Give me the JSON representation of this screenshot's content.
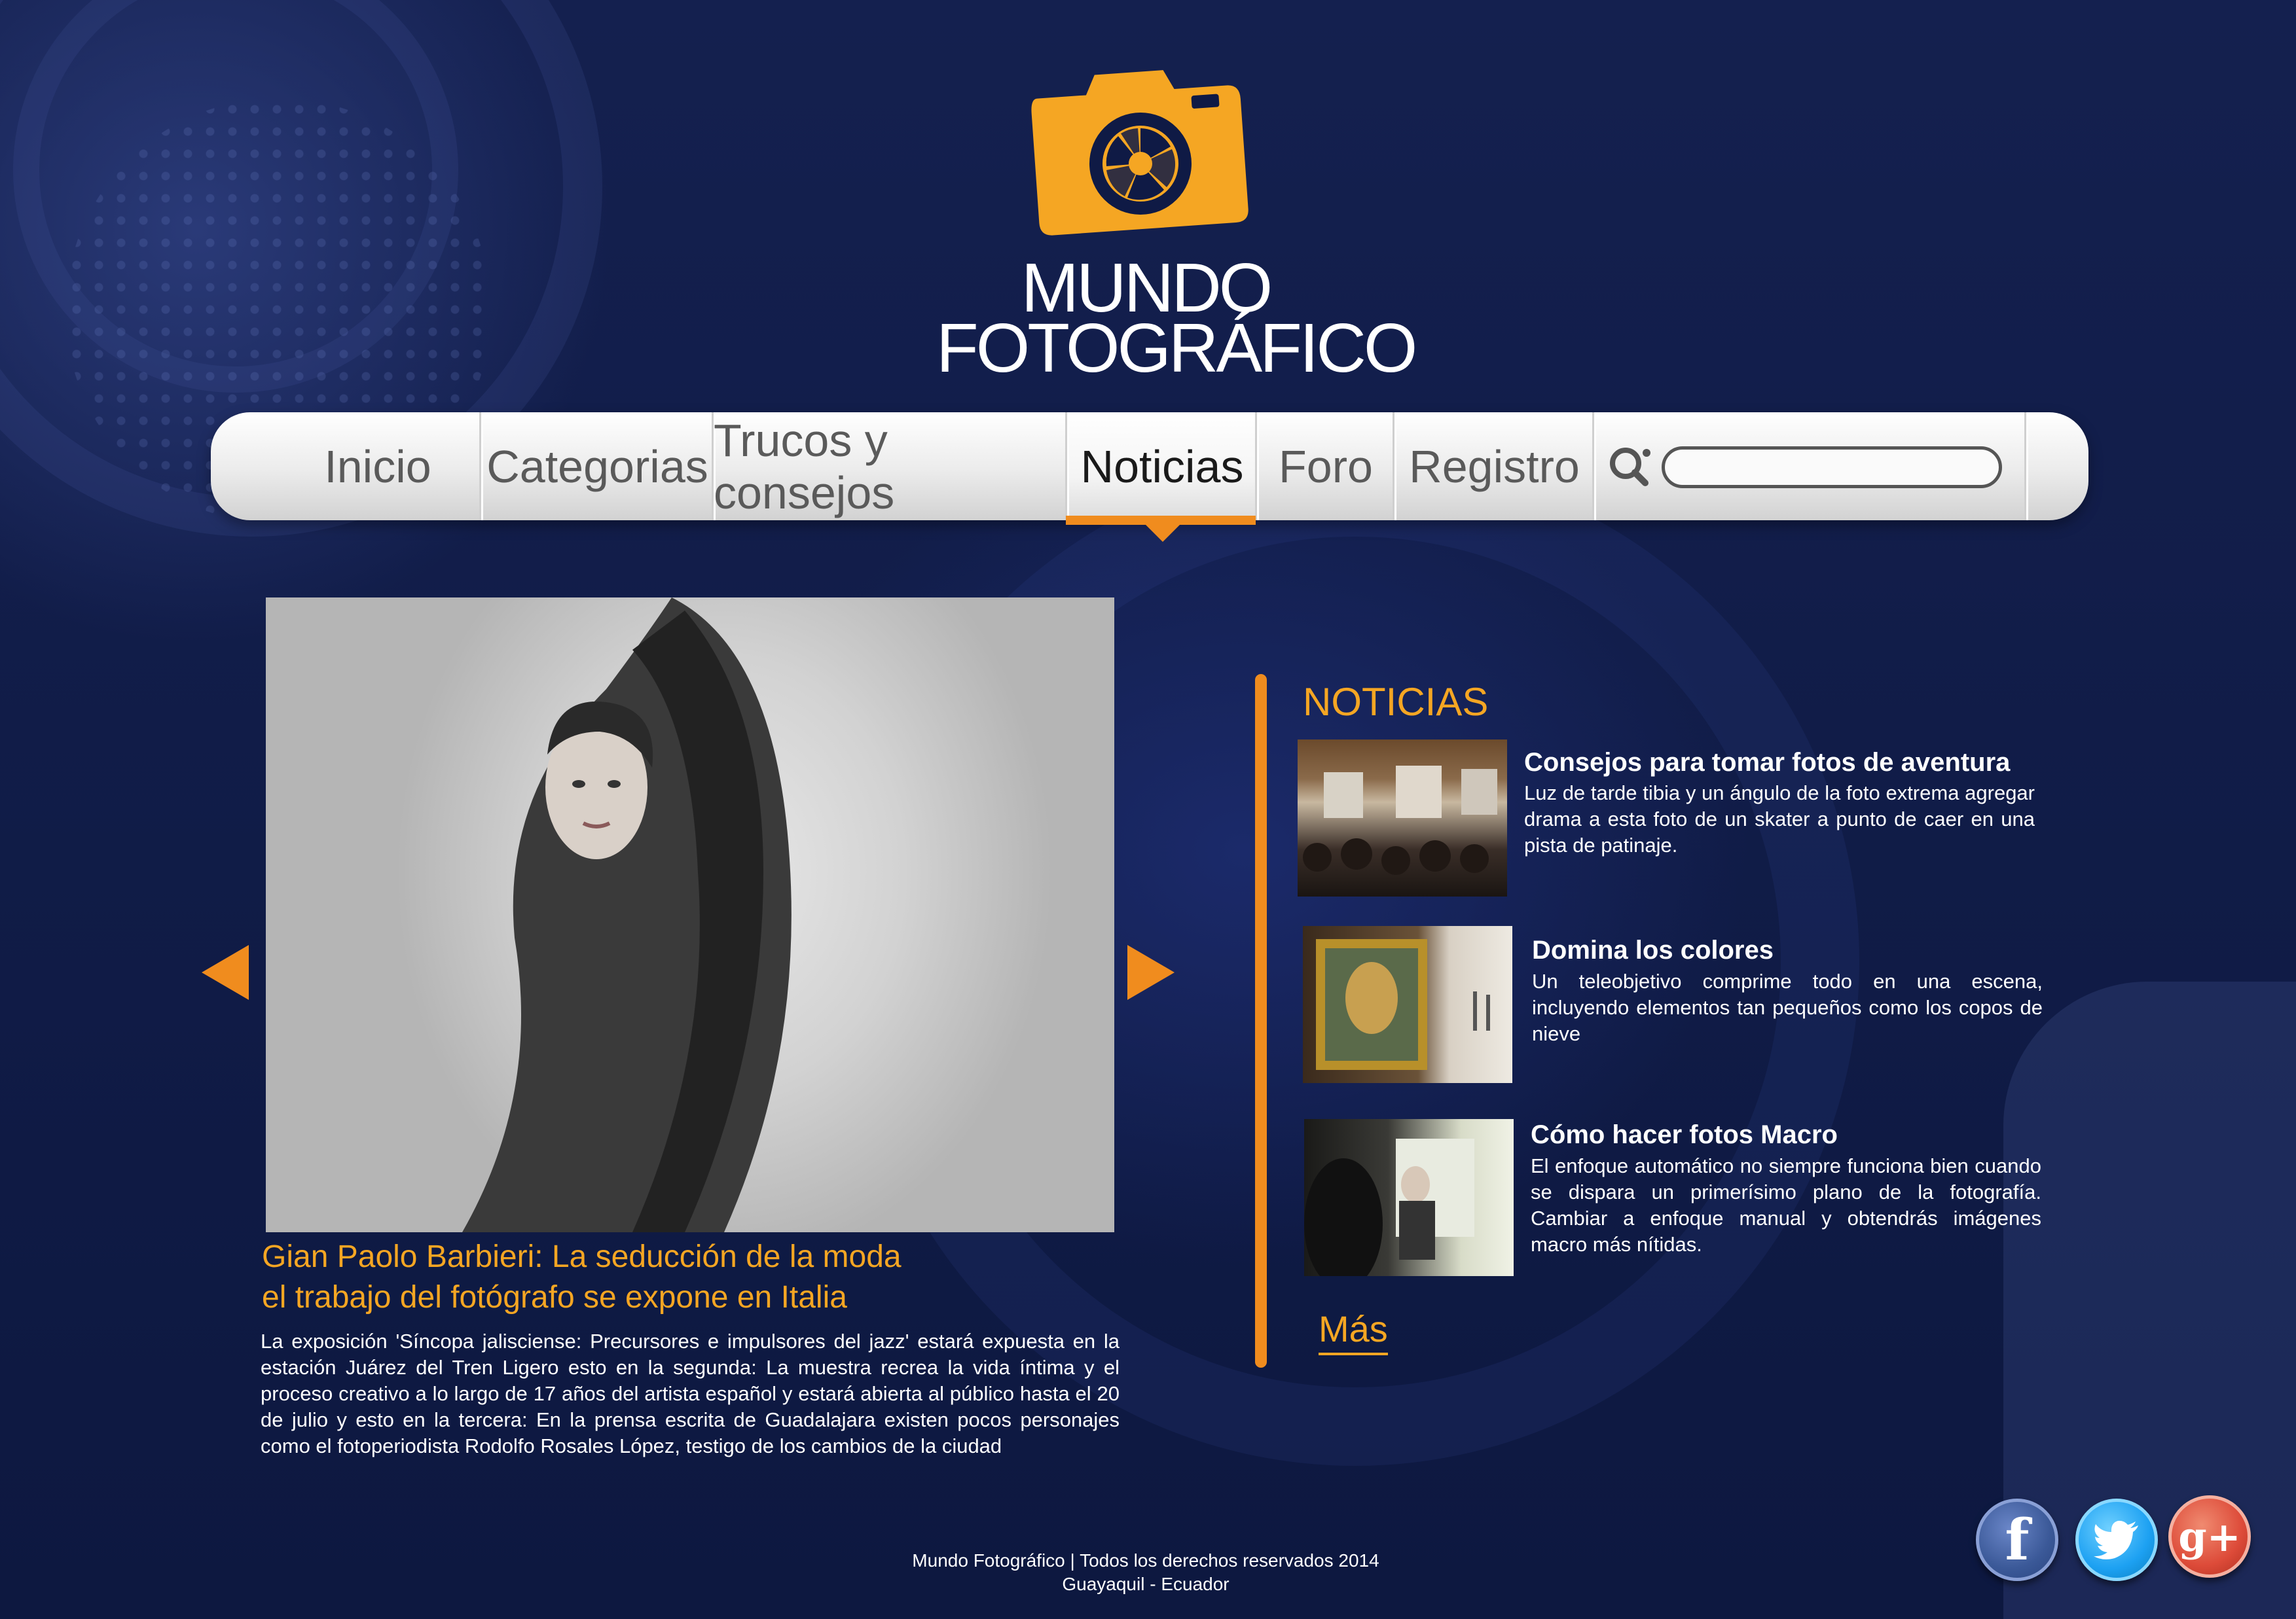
{
  "brand": {
    "name_line1": "MUNDO",
    "name_line2": "FOTOGRÁFICO",
    "accent_color": "#f5a623",
    "logo_icon": "camera-icon"
  },
  "nav": {
    "items": [
      {
        "label": "Inicio"
      },
      {
        "label": "Categorias"
      },
      {
        "label": "Trucos y consejos"
      },
      {
        "label": "Noticias",
        "active": true
      },
      {
        "label": "Foro"
      },
      {
        "label": "Registro"
      }
    ],
    "search": {
      "icon": "search-icon",
      "value": ""
    }
  },
  "feature": {
    "title_line1": "Gian Paolo Barbieri: La seducción de la moda",
    "title_line2": "el trabajo del fotógrafo se expone en Italia",
    "body": "La exposición 'Síncopa jalisciense: Precursores e impulsores del jazz' estará expuesta en la estación Juárez del Tren Ligero esto en la segunda: La muestra recrea la vida íntima y el proceso creativo a lo largo de 17 años del artista español y estará abierta al público hasta el 20 de julio y esto en la tercera: En la prensa escrita de Guadalajara existen pocos personajes como el fotoperiodista Rodolfo Rosales López, testigo de los cambios de la ciudad"
  },
  "news": {
    "heading": "NOTICIAS",
    "items": [
      {
        "title": "Consejos para tomar fotos de aventura",
        "text": "Luz de tarde tibia y un ángulo de la foto extrema agregar drama a esta foto de un skater a punto de caer en una pista de patinaje."
      },
      {
        "title": "Domina los colores",
        "text": "Un teleobjetivo comprime todo en una escena, incluyendo elementos tan pequeños como los copos de nieve"
      },
      {
        "title": "Cómo hacer fotos Macro",
        "text": "El enfoque automático no siempre funciona bien cuando se dispara un primerísimo plano de la fotografía. Cambiar a enfoque manual y obtendrás imágenes macro más nítidas."
      }
    ],
    "more_label": "Más"
  },
  "footer": {
    "line1": "Mundo Fotográfico | Todos los derechos reservados 2014",
    "line2": "Guayaquil - Ecuador"
  },
  "social": [
    {
      "icon": "facebook-icon",
      "glyph": "f",
      "color": "#3b5998"
    },
    {
      "icon": "twitter-icon",
      "glyph": "t",
      "color": "#1da1f2"
    },
    {
      "icon": "google-plus-icon",
      "glyph": "g+",
      "color": "#dd4b39"
    }
  ]
}
